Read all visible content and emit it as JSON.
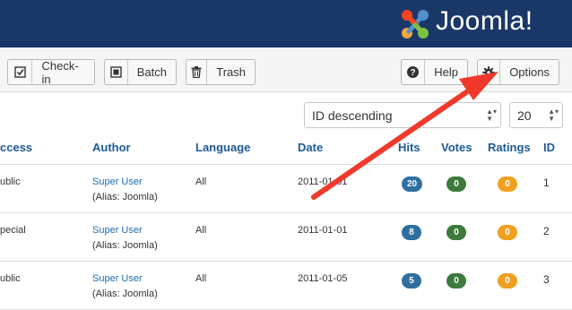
{
  "brand": {
    "name": "Joomla!"
  },
  "toolbar": {
    "checkin_label": "Check-in",
    "batch_label": "Batch",
    "trash_label": "Trash",
    "help_label": "Help",
    "options_label": "Options"
  },
  "filters": {
    "order_value": "ID descending",
    "limit_value": "20"
  },
  "table": {
    "headers": {
      "access": "ccess",
      "author": "Author",
      "language": "Language",
      "date": "Date",
      "hits": "Hits",
      "votes": "Votes",
      "ratings": "Ratings",
      "id": "ID"
    },
    "rows": [
      {
        "access": "ublic",
        "author": "Super User",
        "alias": "(Alias: Joomla)",
        "language": "All",
        "date": "2011-01-01",
        "hits": "20",
        "votes": "0",
        "ratings": "0",
        "id": "1"
      },
      {
        "access": "pecial",
        "author": "Super User",
        "alias": "(Alias: Joomla)",
        "language": "All",
        "date": "2011-01-01",
        "hits": "8",
        "votes": "0",
        "ratings": "0",
        "id": "2"
      },
      {
        "access": "ublic",
        "author": "Super User",
        "alias": "(Alias: Joomla)",
        "language": "All",
        "date": "2011-01-05",
        "hits": "5",
        "votes": "0",
        "ratings": "0",
        "id": "3"
      }
    ]
  },
  "colors": {
    "header_bg": "#1a3867",
    "link": "#1e6cb1",
    "hits_badge": "#2f6f9f",
    "votes_badge": "#3d7a3d",
    "ratings_badge": "#f0a020",
    "annotation_arrow": "#f0392b"
  },
  "icons": {
    "checkin": "checkbox-icon",
    "batch": "square-icon",
    "trash": "trash-icon",
    "help": "question-icon",
    "options": "gear-icon"
  }
}
